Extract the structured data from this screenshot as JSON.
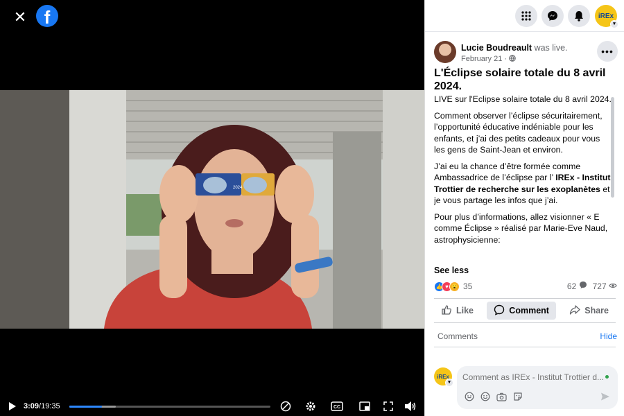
{
  "video": {
    "current_time": "3:09",
    "separator": " / ",
    "duration": "19:35",
    "progress_fraction": 0.161,
    "buffered_fraction": 0.23,
    "brand_color": "#1877f2",
    "glasses_text": "2024"
  },
  "topbar": {
    "icons": [
      "grid-menu-icon",
      "messenger-icon",
      "bell-icon"
    ],
    "profile_label": "iREx"
  },
  "post": {
    "author": "Lucie Boudreault",
    "status": " was live.",
    "date": "February 21",
    "date_sep": " · ",
    "title": "L'Éclipse solaire totale du 8 avril 2024.",
    "paragraphs": [
      "LIVE sur l'Eclipse solaire totale du 8 avril 2024.",
      "Comment observer l’éclipse sécuritairement, l’opportunité éducative indéniable pour les enfants, et j’ai des petits cadeaux pour vous les gens de Saint-Jean et environ."
    ],
    "p3_before": "J’ai eu la chance d’être formée comme Ambassadrice de l’éclipse par l’ ",
    "p3_bold": "IREx - Institut Trottier de recherche sur les exoplanètes",
    "p3_after": " et je vous partage les infos que j’ai.",
    "p4": "Pour plus d’informations, allez visionner « E comme Éclipse » réalisé par Marie-Eve Naud, astrophysicienne:",
    "see_less": "See less",
    "reactions_count": "35",
    "comments_count": "62",
    "views_count": "727",
    "actions": {
      "like": "Like",
      "comment": "Comment",
      "share": "Share"
    }
  },
  "comments": {
    "label": "Comments",
    "hide": "Hide",
    "placeholder": "Comment as IREx - Institut Trottier d...",
    "avatar_label": "iREx"
  }
}
